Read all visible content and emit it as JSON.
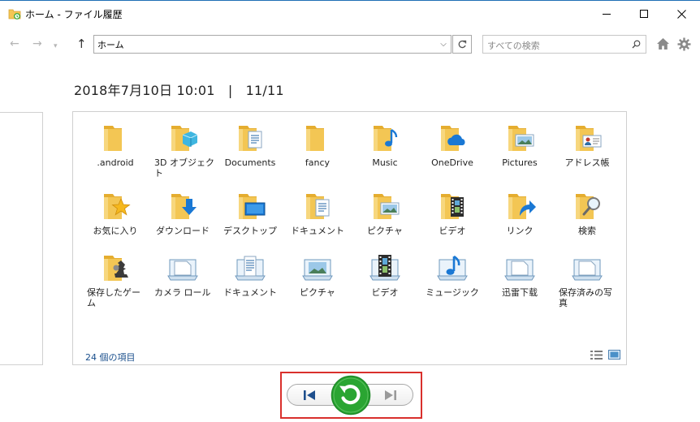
{
  "window": {
    "title": "ホーム - ファイル履歴",
    "minimize_icon": "minimize-icon",
    "maximize_icon": "maximize-icon",
    "close_icon": "close-icon"
  },
  "nav": {
    "back_icon": "arrow-left-icon",
    "forward_icon": "arrow-right-icon",
    "recent_icon": "chevron-down-icon",
    "up_icon": "arrow-up-icon",
    "address_value": "ホーム",
    "address_dropdown_icon": "chevron-down-icon",
    "refresh_icon": "refresh-icon",
    "search_placeholder": "すべての検索",
    "search_icon": "magnifier-icon",
    "home_icon": "home-icon",
    "settings_icon": "gear-icon"
  },
  "header": {
    "timestamp": "2018年7月10日 10:01　|　11/11"
  },
  "files": [
    {
      "label": ".android",
      "icon": "folder-icon"
    },
    {
      "label": "3D オブジェクト",
      "icon": "folder-3d-objects-icon"
    },
    {
      "label": "Documents",
      "icon": "folder-documents-icon"
    },
    {
      "label": "fancy",
      "icon": "folder-icon"
    },
    {
      "label": "Music",
      "icon": "folder-music-icon"
    },
    {
      "label": "OneDrive",
      "icon": "folder-onedrive-icon"
    },
    {
      "label": "Pictures",
      "icon": "folder-pictures-icon"
    },
    {
      "label": "アドレス帳",
      "icon": "folder-contacts-icon"
    },
    {
      "label": "お気に入り",
      "icon": "folder-favorites-icon"
    },
    {
      "label": "ダウンロード",
      "icon": "folder-downloads-icon"
    },
    {
      "label": "デスクトップ",
      "icon": "folder-desktop-icon"
    },
    {
      "label": "ドキュメント",
      "icon": "folder-documents-icon"
    },
    {
      "label": "ピクチャ",
      "icon": "folder-pictures-icon"
    },
    {
      "label": "ビデオ",
      "icon": "folder-videos-icon"
    },
    {
      "label": "リンク",
      "icon": "folder-links-icon"
    },
    {
      "label": "検索",
      "icon": "folder-searches-icon"
    },
    {
      "label": "保存したゲーム",
      "icon": "folder-saved-games-icon"
    },
    {
      "label": "カメラ ロール",
      "icon": "library-camera-roll-icon"
    },
    {
      "label": "ドキュメント",
      "icon": "library-documents-icon"
    },
    {
      "label": "ピクチャ",
      "icon": "library-pictures-icon"
    },
    {
      "label": "ビデオ",
      "icon": "library-videos-icon"
    },
    {
      "label": "ミュージック",
      "icon": "library-music-icon"
    },
    {
      "label": "迅雷下载",
      "icon": "library-icon"
    },
    {
      "label": "保存済みの写真",
      "icon": "library-saved-pictures-icon"
    }
  ],
  "status": {
    "item_count": "24 個の項目",
    "details_view_icon": "details-view-icon",
    "large_icons_view_icon": "large-icons-view-icon"
  },
  "playback": {
    "previous_icon": "previous-version-icon",
    "restore_icon": "restore-icon",
    "next_icon": "next-version-icon",
    "highlight_color": "#d9302c",
    "restore_color": "#2aa532"
  },
  "colors": {
    "folder": "#f3c654",
    "folder_dark": "#e5ad2f",
    "accent_blue": "#1f6fb5"
  }
}
